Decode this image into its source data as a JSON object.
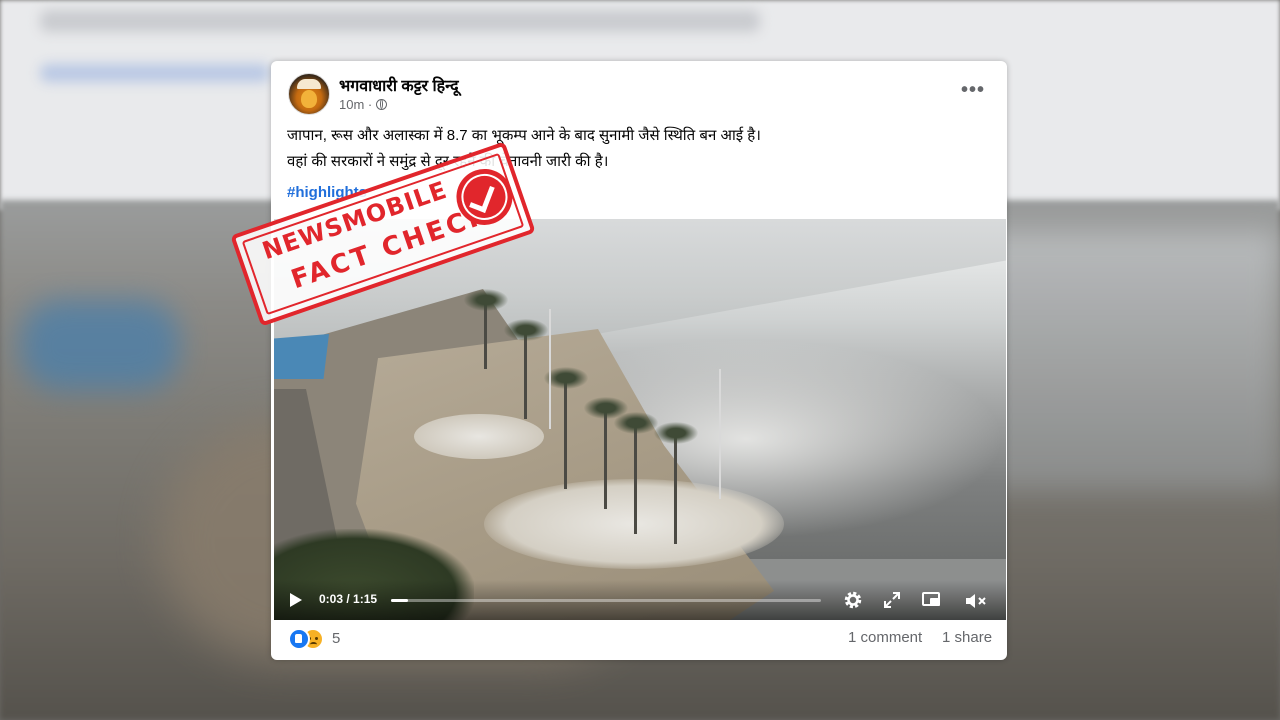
{
  "post": {
    "author": "भगवाधारी कट्टर हिन्दू",
    "time": "10m ·",
    "privacy_icon": "globe-icon",
    "caption_line1": "जापान, रूस और अलास्का में 8.7 का भूकम्प आने के बाद सुनामी जैसे स्थिति बन आई है।",
    "caption_line2": "वहां की सरकारों ने समुंद्र से दूर रहने की चेतावनी जारी की है।",
    "hashtag": "#highlights",
    "more_label": "•••"
  },
  "video": {
    "time_display": "0:03 / 1:15",
    "progress": 0.04,
    "controls": [
      "play-icon",
      "settings-icon",
      "fullscreen-icon",
      "picture-in-picture-icon",
      "mute-icon"
    ]
  },
  "footer": {
    "reaction_count": "5",
    "comments": "1 comment",
    "shares": "1 share"
  },
  "stamp": {
    "line1": "NEWSMOBILE",
    "line2": "FACT CHECK",
    "color": "#e1262c"
  },
  "colors": {
    "link": "#216fdb",
    "secondary_text": "#65676b",
    "like_blue": "#1877f2"
  }
}
